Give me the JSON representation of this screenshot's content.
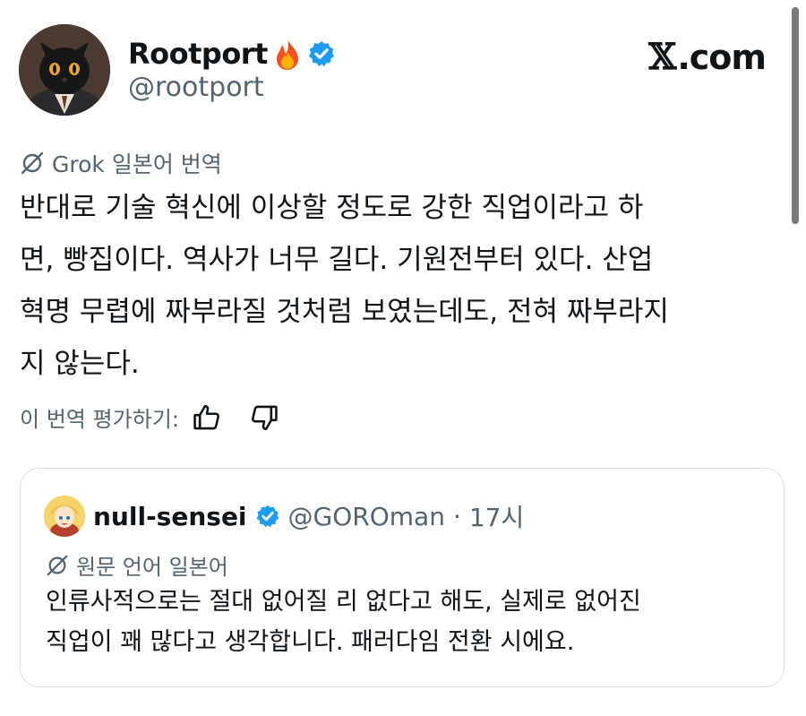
{
  "author": {
    "display_name": "Rootport",
    "handle": "@rootport",
    "badge_emoji": "🔥",
    "verified_color": "#1d9bf0"
  },
  "brand": {
    "x_mark": "𝕏",
    "domain": ".com"
  },
  "translation": {
    "label": "Grok 일본어 번역",
    "lines": [
      "반대로 기술 혁신에 이상할 정도로 강한 직업이라고 하",
      "면, 빵집이다. 역사가 너무 길다. 기원전부터 있다. 산업",
      "혁명 무렵에 짜부라질 것처럼 보였는데도, 전혀 짜부라지",
      "지 않는다."
    ],
    "rate_label": "이 번역 평가하기:"
  },
  "quote": {
    "display_name": "null-sensei",
    "handle": "@GOROman",
    "separator": "·",
    "time": "17시",
    "original_language_label": "원문 언어 일본어",
    "lines": [
      "인류사적으로는 절대 없어질 리 없다고 해도, 실제로 없어진",
      "직업이 꽤 많다고 생각합니다. 패러다임 전환 시에요."
    ]
  }
}
